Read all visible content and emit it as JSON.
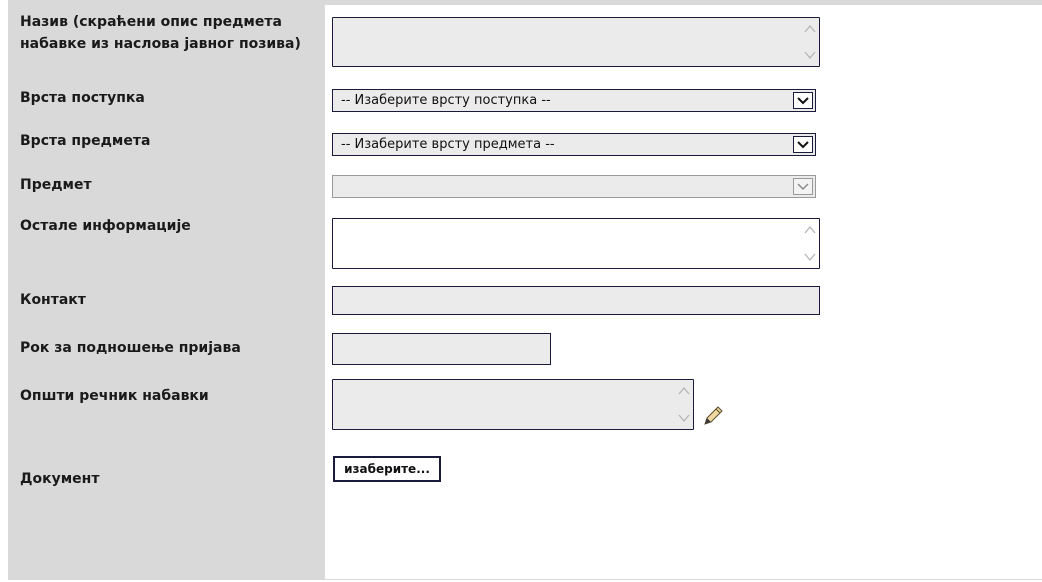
{
  "form": {
    "fields": {
      "naziv": {
        "label_line1": "Назив (скраћени опис предмета",
        "label_line2": "набавке из наслова јавног позива)",
        "value": ""
      },
      "vrsta_postupka": {
        "label": "Врста поступка",
        "selected": "-- Изаберите врсту поступка --"
      },
      "vrsta_predmeta": {
        "label": "Врста предмета",
        "selected": "-- Изаберите врсту предмета --"
      },
      "predmet": {
        "label": "Предмет",
        "selected": ""
      },
      "ostale_informacije": {
        "label": "Остале информације",
        "value": ""
      },
      "kontakt": {
        "label": "Контакт",
        "value": ""
      },
      "rok": {
        "label": "Рок за подношење пријава",
        "value": ""
      },
      "opsti_recnik": {
        "label": "Општи речник набавки",
        "value": ""
      },
      "dokument": {
        "label": "Документ",
        "button_label": "изаберите..."
      }
    }
  },
  "colors": {
    "label_background": "#d9d9d9",
    "field_background": "#ebebeb",
    "field_border": "#1a1a3a"
  },
  "icons": {
    "textarea_scroll_up": "chevron-up-icon",
    "textarea_scroll_down": "chevron-down-icon",
    "select_arrow": "chevron-down-icon",
    "edit": "pencil-icon"
  }
}
